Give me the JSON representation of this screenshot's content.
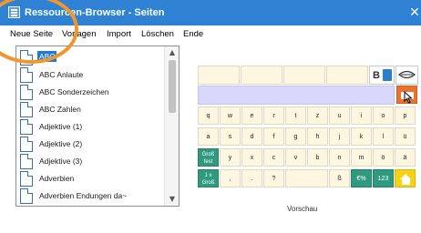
{
  "window": {
    "title": "Ressourcen-Browser - Seiten",
    "close_glyph": "✕"
  },
  "menu": {
    "items": [
      "Neue Seite",
      "Vorlagen",
      "Import",
      "Löschen",
      "Ende"
    ]
  },
  "page_list": {
    "items": [
      {
        "label": "ABC",
        "selected": true
      },
      {
        "label": "ABC Anlaute",
        "selected": false
      },
      {
        "label": "ABC Sonderzeichen",
        "selected": false
      },
      {
        "label": "ABC Zahlen",
        "selected": false
      },
      {
        "label": "Adjektive (1)",
        "selected": false
      },
      {
        "label": "Adjektive (2)",
        "selected": false
      },
      {
        "label": "Adjektive (3)",
        "selected": false
      },
      {
        "label": "Adverbien",
        "selected": false
      },
      {
        "label": "Adverbien Endungen da~",
        "selected": false
      }
    ],
    "scroll_up": "▲",
    "scroll_down": "▼"
  },
  "preview": {
    "book_label": "B",
    "rows": [
      [
        "q",
        "w",
        "e",
        "r",
        "t",
        "z",
        "u",
        "i",
        "o",
        "p"
      ],
      [
        "a",
        "s",
        "d",
        "f",
        "g",
        "h",
        "j",
        "k",
        "l",
        "ü"
      ],
      [
        "Groß fest",
        "y",
        "x",
        "c",
        "v",
        "b",
        "n",
        "m",
        "ö",
        "ä"
      ],
      [
        "1 x Groß",
        ",",
        ".",
        "?",
        "",
        "ß",
        "€%",
        "123",
        ""
      ]
    ],
    "caption": "Vorschau"
  },
  "colors": {
    "titlebar": "#2f82d3",
    "selection": "#1f7ad6",
    "key_bg": "#fdf7e2",
    "key_green": "#2f9a80",
    "key_yellow": "#f7d117",
    "sentence_bar": "#d9d8fb",
    "keyboard_orange": "#e8722e",
    "highlight_ring": "#f0962c"
  },
  "icons": [
    "app-icon",
    "close-icon",
    "document-icon",
    "book-icon",
    "keyboard-icon",
    "home-icon",
    "mouse-cursor-icon"
  ]
}
